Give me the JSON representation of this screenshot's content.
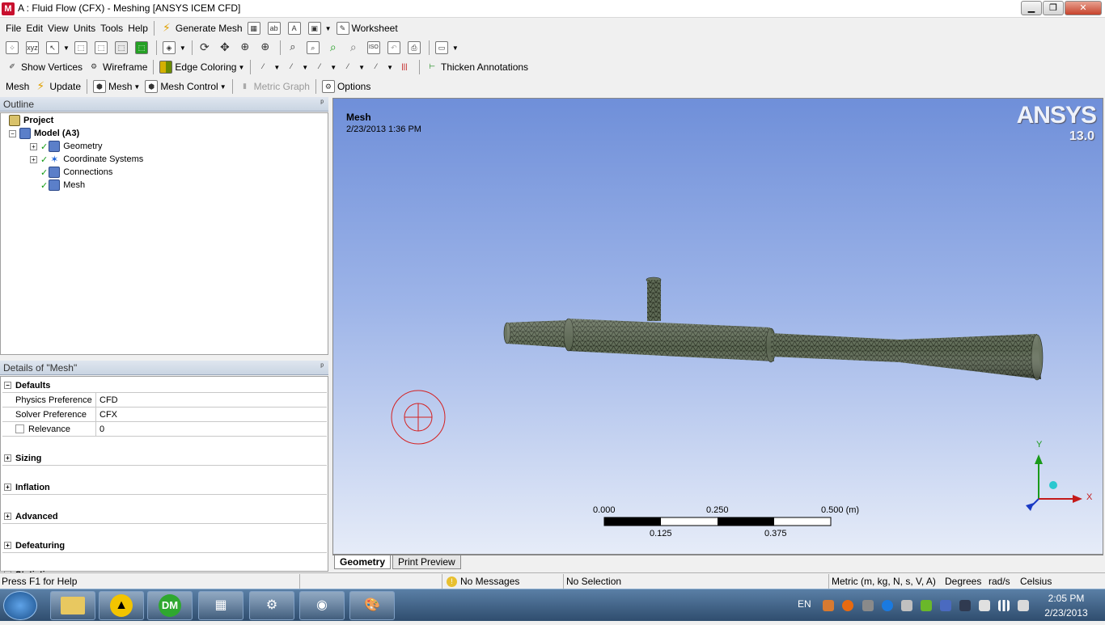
{
  "window": {
    "app_letter": "M",
    "title": "A : Fluid Flow (CFX) - Meshing [ANSYS ICEM CFD]",
    "minimize": "▁",
    "restore": "❐",
    "close": "✕"
  },
  "menubar": {
    "items": [
      "File",
      "Edit",
      "View",
      "Units",
      "Tools",
      "Help"
    ],
    "generate_mesh": "Generate Mesh",
    "worksheet": "Worksheet"
  },
  "toolbar2": {
    "show_vertices": "Show Vertices",
    "wireframe": "Wireframe",
    "edge_coloring": "Edge Coloring",
    "thicken_annotations": "Thicken Annotations"
  },
  "mesh_toolbar": {
    "mesh": "Mesh",
    "update": "Update",
    "mesh_dropdown": "Mesh",
    "mesh_control": "Mesh Control",
    "metric_graph": "Metric Graph",
    "options": "Options"
  },
  "outline": {
    "header": "Outline",
    "pin": "ᵖ",
    "tree": [
      {
        "label": "Project",
        "bold": true
      },
      {
        "label": "Model (A3)",
        "bold": true
      },
      {
        "label": "Geometry"
      },
      {
        "label": "Coordinate Systems"
      },
      {
        "label": "Connections"
      },
      {
        "label": "Mesh"
      }
    ]
  },
  "details": {
    "header": "Details of \"Mesh\"",
    "defaults": "Defaults",
    "physics_pref_label": "Physics Preference",
    "physics_pref_value": "CFD",
    "solver_pref_label": "Solver Preference",
    "solver_pref_value": "CFX",
    "relevance_label": "Relevance",
    "relevance_value": "0",
    "groups": [
      "Sizing",
      "Inflation",
      "Advanced",
      "Defeaturing",
      "Statistics"
    ]
  },
  "viewport": {
    "title": "Mesh",
    "date": "2/23/2013 1:36 PM",
    "logo": "ANSYS",
    "version": "13.0",
    "scale": {
      "top": [
        "0.000",
        "0.250",
        "0.500 (m)"
      ],
      "bottom": [
        "0.125",
        "0.375"
      ]
    },
    "axis_y": "Y",
    "axis_x": "X"
  },
  "tabs": {
    "geometry": "Geometry",
    "print_preview": "Print Preview"
  },
  "statusbar": {
    "help": "Press F1 for Help",
    "messages": "No Messages",
    "selection": "No Selection",
    "units": "Metric (m, kg, N, s, V, A)",
    "degrees": "Degrees",
    "rads": "rad/s",
    "temp": "Celsius"
  },
  "taskbar": {
    "lang": "EN",
    "time": "2:05 PM",
    "date": "2/23/2013",
    "dm_label": "DM"
  },
  "colors": {
    "check": "#139b13",
    "mesh_fill": "#5e6a55",
    "mesh_line": "#1e2418"
  }
}
